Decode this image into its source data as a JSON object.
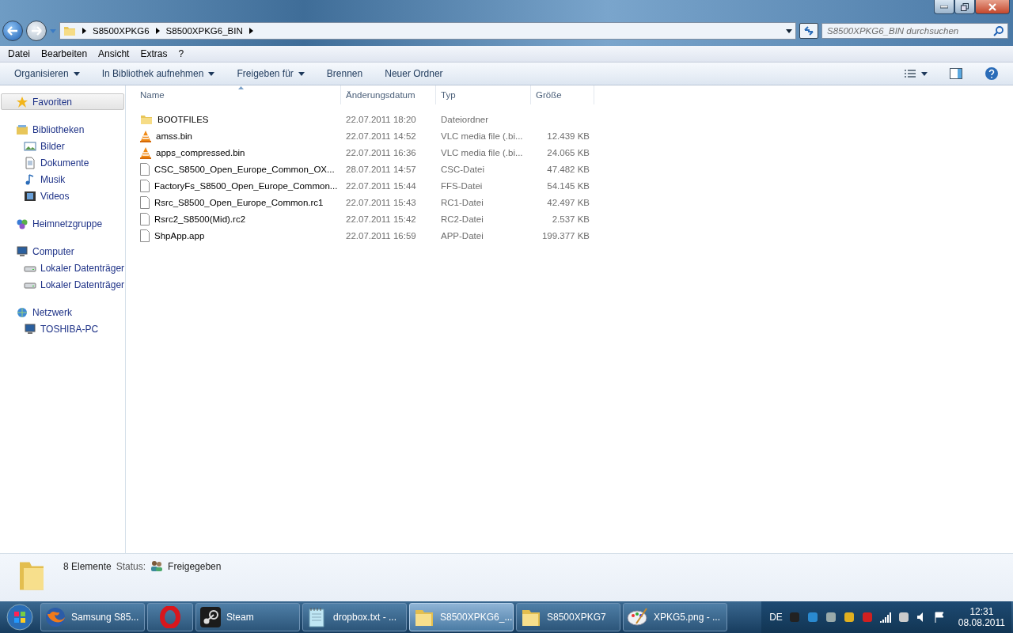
{
  "address_bar": {
    "crumbs": [
      "S8500XPKG6",
      "S8500XPKG6_BIN"
    ],
    "search": {
      "placeholder": "S8500XPKG6_BIN durchsuchen"
    }
  },
  "menu_bar": [
    "Datei",
    "Bearbeiten",
    "Ansicht",
    "Extras",
    "?"
  ],
  "toolbar": [
    {
      "label": "Organisieren",
      "dropdown": true
    },
    {
      "label": "In Bibliothek aufnehmen",
      "dropdown": true
    },
    {
      "label": "Freigeben für",
      "dropdown": true
    },
    {
      "label": "Brennen",
      "dropdown": false
    },
    {
      "label": "Neuer Ordner",
      "dropdown": false
    }
  ],
  "sidebar": [
    {
      "label": "Favoriten",
      "kind": "star",
      "selected": true
    },
    {
      "label": "Bibliotheken",
      "kind": "library",
      "selected": false,
      "children": [
        {
          "label": "Bilder",
          "kind": "pictures",
          "selected": false
        },
        {
          "label": "Dokumente",
          "kind": "documents",
          "selected": false
        },
        {
          "label": "Musik",
          "kind": "music",
          "selected": false
        },
        {
          "label": "Videos",
          "kind": "videos",
          "selected": false
        }
      ]
    },
    {
      "label": "Heimnetzgruppe",
      "kind": "homegroup",
      "selected": false
    },
    {
      "label": "Computer",
      "kind": "computer",
      "selected": false,
      "children": [
        {
          "label": "Lokaler Datenträger",
          "kind": "drive",
          "selected": false
        },
        {
          "label": "Lokaler Datenträger",
          "kind": "drive",
          "selected": false
        }
      ]
    },
    {
      "label": "Netzwerk",
      "kind": "network",
      "selected": false,
      "children": [
        {
          "label": "TOSHIBA-PC",
          "kind": "computer",
          "selected": false
        }
      ]
    }
  ],
  "table": {
    "columns": [
      {
        "label": "Name",
        "sorted": true
      },
      {
        "label": "Änderungsdatum",
        "sorted": false
      },
      {
        "label": "Typ",
        "sorted": false
      },
      {
        "label": "Größe",
        "sorted": false
      }
    ],
    "rows": [
      {
        "kind": "folder",
        "name": "BOOTFILES",
        "date": "22.07.2011 18:20",
        "type": "Dateiordner"
      },
      {
        "kind": "vlc",
        "name": "amss.bin",
        "date": "22.07.2011 14:52",
        "type": "VLC media file (.bi...",
        "size": "12.439 KB"
      },
      {
        "kind": "vlc",
        "name": "apps_compressed.bin",
        "date": "22.07.2011 16:36",
        "type": "VLC media file (.bi...",
        "size": "24.065 KB"
      },
      {
        "kind": "file",
        "name": "CSC_S8500_Open_Europe_Common_OX...",
        "date": "28.07.2011 14:57",
        "type": "CSC-Datei",
        "size": "47.482 KB"
      },
      {
        "kind": "file",
        "name": "FactoryFs_S8500_Open_Europe_Common...",
        "date": "22.07.2011 15:44",
        "type": "FFS-Datei",
        "size": "54.145 KB"
      },
      {
        "kind": "file",
        "name": "Rsrc_S8500_Open_Europe_Common.rc1",
        "date": "22.07.2011 15:43",
        "type": "RC1-Datei",
        "size": "42.497 KB"
      },
      {
        "kind": "file",
        "name": "Rsrc2_S8500(Mid).rc2",
        "date": "22.07.2011 15:42",
        "type": "RC2-Datei",
        "size": "2.537 KB"
      },
      {
        "kind": "file",
        "name": "ShpApp.app",
        "date": "22.07.2011 16:59",
        "type": "APP-Datei",
        "size": "199.377 KB"
      }
    ]
  },
  "status_bar": {
    "count": "8 Elemente",
    "status_label": "Status:",
    "status_value": "Freigegeben"
  },
  "taskbar": {
    "items": [
      {
        "kind": "firefox",
        "label": "Samsung S85...",
        "selected": false
      },
      {
        "kind": "opera",
        "selected": false
      },
      {
        "kind": "steam",
        "label": "Steam",
        "selected": false
      },
      {
        "kind": "notepad",
        "label": "dropbox.txt - ...",
        "selected": false
      },
      {
        "kind": "folder",
        "label": "S8500XPKG6_...",
        "selected": true
      },
      {
        "kind": "folder",
        "label": "S8500XPKG7",
        "selected": false
      },
      {
        "kind": "paint",
        "label": "XPKG5.png - ...",
        "selected": false
      }
    ],
    "language": "DE",
    "time": "12:31",
    "date": "08.08.2011"
  }
}
